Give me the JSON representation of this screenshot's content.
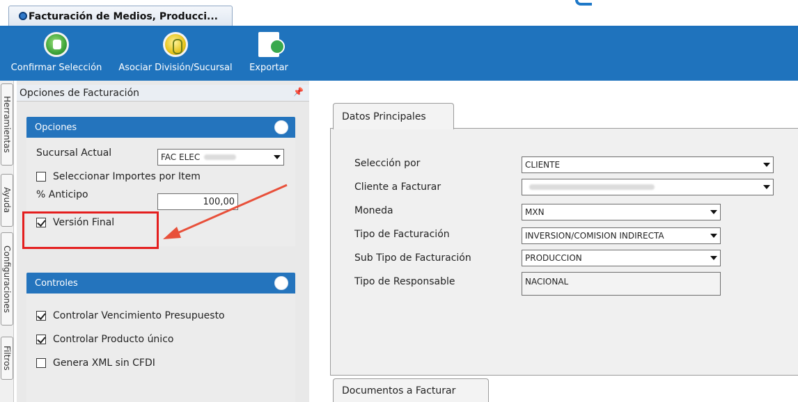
{
  "window": {
    "tab_title": "Facturación de Medios, Producci..."
  },
  "ribbon": {
    "buttons": [
      {
        "label": "Confirmar Selección",
        "icon": "thumbs-up-icon"
      },
      {
        "label": "Asociar División/Sucursal",
        "icon": "associate-icon"
      },
      {
        "label": "Exportar",
        "icon": "export-icon"
      }
    ]
  },
  "side_tabs": [
    "Herramientas",
    "Ayuda",
    "Configuraciones",
    "Filtros"
  ],
  "left_panel": {
    "title": "Opciones de Facturación",
    "opciones": {
      "header": "Opciones",
      "sucursal_label": "Sucursal Actual",
      "sucursal_value": "FAC ELEC",
      "seleccionar_importes_label": "Seleccionar Importes por Item",
      "seleccionar_importes_checked": false,
      "anticipo_label": "% Anticipo",
      "anticipo_value": "100,00",
      "version_final_label": "Versión Final",
      "version_final_checked": true
    },
    "controles": {
      "header": "Controles",
      "items": [
        {
          "label": "Controlar Vencimiento Presupuesto",
          "checked": true
        },
        {
          "label": "Controlar Producto único",
          "checked": true
        },
        {
          "label": "Genera XML sin CFDI",
          "checked": false
        }
      ]
    }
  },
  "main": {
    "tab_datos": "Datos Principales",
    "fields": {
      "seleccion_label": "Selección por",
      "seleccion_value": "CLIENTE",
      "cliente_label": "Cliente a Facturar",
      "cliente_value": "",
      "moneda_label": "Moneda",
      "moneda_value": "MXN",
      "tipo_fact_label": "Tipo de Facturación",
      "tipo_fact_value": "INVERSION/COMISION INDIRECTA",
      "subtipo_label": "Sub Tipo de Facturación",
      "subtipo_value": "PRODUCCION",
      "responsable_label": "Tipo de Responsable",
      "responsable_value": "NACIONAL"
    },
    "tab_docs": "Documentos a Facturar"
  },
  "colors": {
    "ribbon": "#1f73bd",
    "group_header": "#2474bd",
    "highlight": "#e41e1e"
  }
}
